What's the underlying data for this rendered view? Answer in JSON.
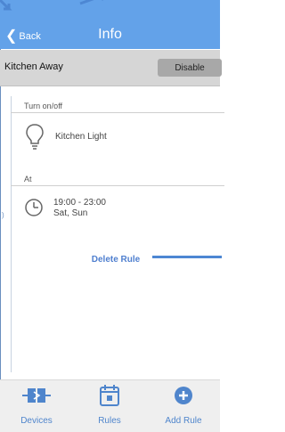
{
  "header": {
    "back_label": "Back",
    "title": "Info"
  },
  "rule": {
    "name": "Kitchen Away",
    "disable_label": "Disable"
  },
  "sections": {
    "turn_label": "Turn on/off",
    "device_name": "Kitchen Light",
    "at_label": "At",
    "time_range": "19:00 - 23:00",
    "days": "Sat, Sun"
  },
  "actions": {
    "delete_label": "Delete Rule"
  },
  "tabs": [
    {
      "label": "Devices",
      "icon": "plug-icon"
    },
    {
      "label": "Rules",
      "icon": "calendar-icon"
    },
    {
      "label": "Add Rule",
      "icon": "plus-circle-icon"
    }
  ],
  "colors": {
    "header_bg": "#63a2e9",
    "accent": "#4f85cc",
    "rule_bar_bg": "#d6d6d6",
    "disable_button": "#a8a8a8"
  }
}
